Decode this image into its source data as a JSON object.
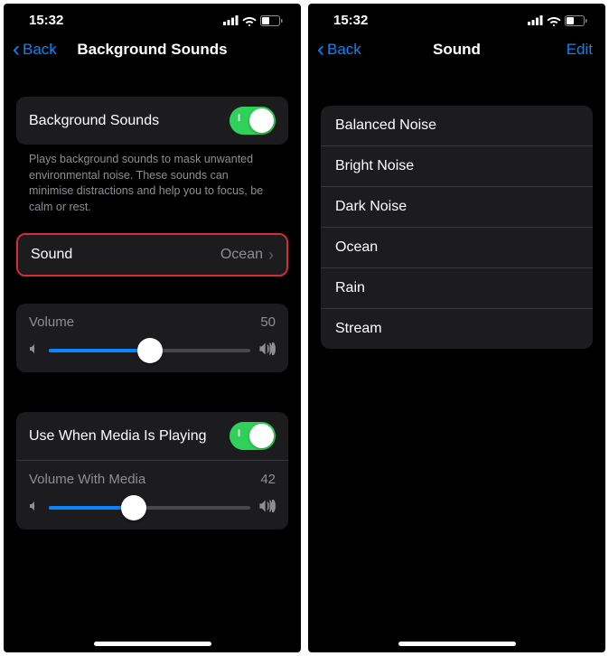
{
  "left": {
    "status": {
      "time": "15:32"
    },
    "nav": {
      "back": "Back",
      "title": "Background Sounds"
    },
    "bgSounds": {
      "label": "Background Sounds",
      "footer": "Plays background sounds to mask unwanted environmental noise. These sounds can minimise distractions and help you to focus, be calm or rest."
    },
    "sound": {
      "label": "Sound",
      "value": "Ocean"
    },
    "volume": {
      "label": "Volume",
      "value": "50"
    },
    "media": {
      "toggleLabel": "Use When Media Is Playing",
      "volumeLabel": "Volume With Media",
      "volumeValue": "42"
    }
  },
  "right": {
    "status": {
      "time": "15:32"
    },
    "nav": {
      "back": "Back",
      "title": "Sound",
      "edit": "Edit"
    },
    "sounds": {
      "0": "Balanced Noise",
      "1": "Bright Noise",
      "2": "Dark Noise",
      "3": "Ocean",
      "4": "Rain",
      "5": "Stream"
    }
  }
}
